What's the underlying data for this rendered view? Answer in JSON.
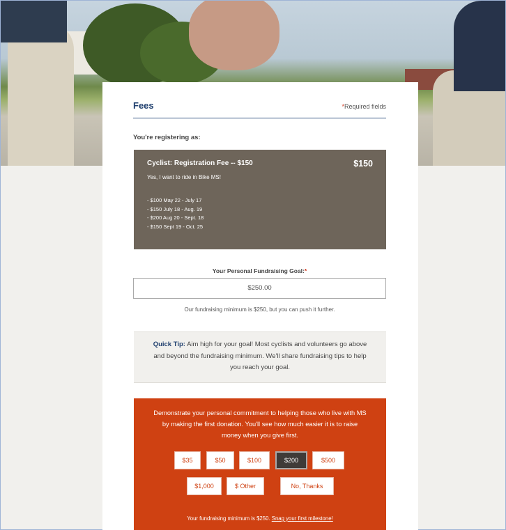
{
  "fees": {
    "title": "Fees",
    "required_star": "*",
    "required_text": "Required fields"
  },
  "registering_label": "You're registering as:",
  "registration": {
    "name": "Cyclist: Registration Fee -- $150",
    "price": "$150",
    "description": "Yes, I want to ride in Bike MS!",
    "schedule": [
      "- $100 May 22 - July 17",
      "- $150 July 18 - Aug. 19",
      "- $200 Aug 20 - Sept. 18",
      "- $150 Sept 19 - Oct. 25"
    ]
  },
  "goal": {
    "label": "Your Personal Fundraising Goal:",
    "required_star": "*",
    "value": "$250.00",
    "note": "Our fundraising minimum is $250, but you can push it further."
  },
  "tip": {
    "label": "Quick Tip:",
    "text": " Aim high for your goal! Most cyclists and volunteers go above and beyond the fundraising minimum. We'll share fundraising tips to help you reach your goal."
  },
  "donation": {
    "text": "Demonstrate your personal commitment to helping those who live with MS by making the first donation. You'll see how much easier it is to raise money when you give first.",
    "amounts": [
      "$35",
      "$50",
      "$100",
      "$200",
      "$500",
      "$1,000",
      "$ Other",
      "No, Thanks"
    ],
    "selected": "$200",
    "footer_text": "Your fundraising minimum is $250. ",
    "footer_link": "Snag your first milestone!"
  },
  "colors": {
    "accent_blue": "#1f3f6e",
    "fee_box": "#6e655a",
    "donation_orange": "#cf4112",
    "required_red": "#d0361c"
  }
}
